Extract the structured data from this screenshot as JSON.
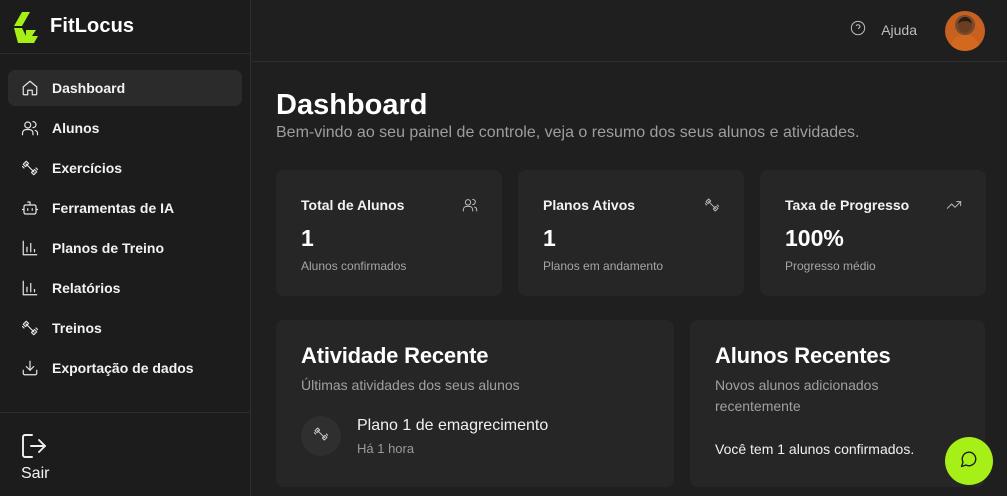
{
  "app": {
    "name": "FitLocus",
    "accent": "#a6f018"
  },
  "sidebar": {
    "items": [
      {
        "label": "Dashboard",
        "icon": "home-icon",
        "active": true
      },
      {
        "label": "Alunos",
        "icon": "users-icon"
      },
      {
        "label": "Exercícios",
        "icon": "dumbbell-icon"
      },
      {
        "label": "Ferramentas de IA",
        "icon": "bot-icon"
      },
      {
        "label": "Planos de Treino",
        "icon": "bar-chart-icon"
      },
      {
        "label": "Relatórios",
        "icon": "bar-chart-icon"
      },
      {
        "label": "Treinos",
        "icon": "dumbbell-icon"
      },
      {
        "label": "Exportação de dados",
        "icon": "download-icon"
      }
    ],
    "logout_label": "Sair"
  },
  "header": {
    "help_label": "Ajuda"
  },
  "page": {
    "title": "Dashboard",
    "subtitle": "Bem-vindo ao seu painel de controle, veja o resumo dos seus alunos e atividades."
  },
  "stats": [
    {
      "title": "Total de Alunos",
      "value": "1",
      "desc": "Alunos confirmados",
      "icon": "users-icon"
    },
    {
      "title": "Planos Ativos",
      "value": "1",
      "desc": "Planos em andamento",
      "icon": "dumbbell-icon"
    },
    {
      "title": "Taxa de Progresso",
      "value": "100%",
      "desc": "Progresso médio",
      "icon": "trending-up-icon"
    }
  ],
  "activity": {
    "title": "Atividade Recente",
    "subtitle": "Últimas atividades dos seus alunos",
    "items": [
      {
        "title": "Plano 1 de emagrecimento",
        "time": "Há 1 hora"
      }
    ]
  },
  "students": {
    "title": "Alunos Recentes",
    "subtitle": "Novos alunos adicionados recentemente",
    "text": "Você tem 1 alunos confirmados."
  }
}
